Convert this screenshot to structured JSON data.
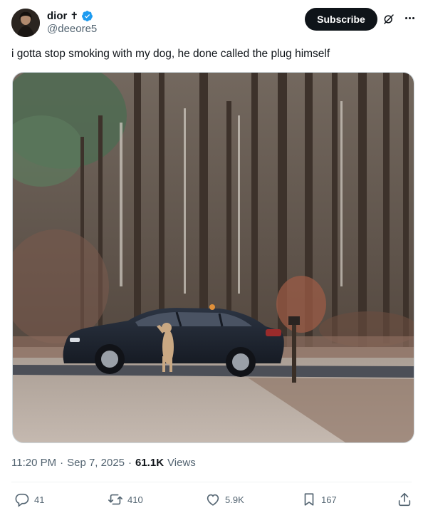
{
  "author": {
    "name": "dior",
    "name_symbol": "✝",
    "handle": "@deeore5",
    "verified": true
  },
  "header": {
    "subscribe_label": "Subscribe",
    "icons": [
      "grok-icon",
      "more-icon"
    ]
  },
  "tweet": {
    "text": "i gotta stop smoking with my dog, he done called the plug himself"
  },
  "meta": {
    "time": "11:20 PM",
    "separator1": "·",
    "date": "Sep 7, 2025",
    "separator2": "·",
    "views_count": "61.1K",
    "views_label": "Views"
  },
  "actions": {
    "replies": "41",
    "reposts": "410",
    "likes": "5.9K",
    "bookmarks": "167"
  },
  "colors": {
    "primary_text": "#0f1419",
    "secondary_text": "#536471",
    "verified_blue": "#1d9bf0",
    "subscribe_bg": "#0f1419"
  }
}
